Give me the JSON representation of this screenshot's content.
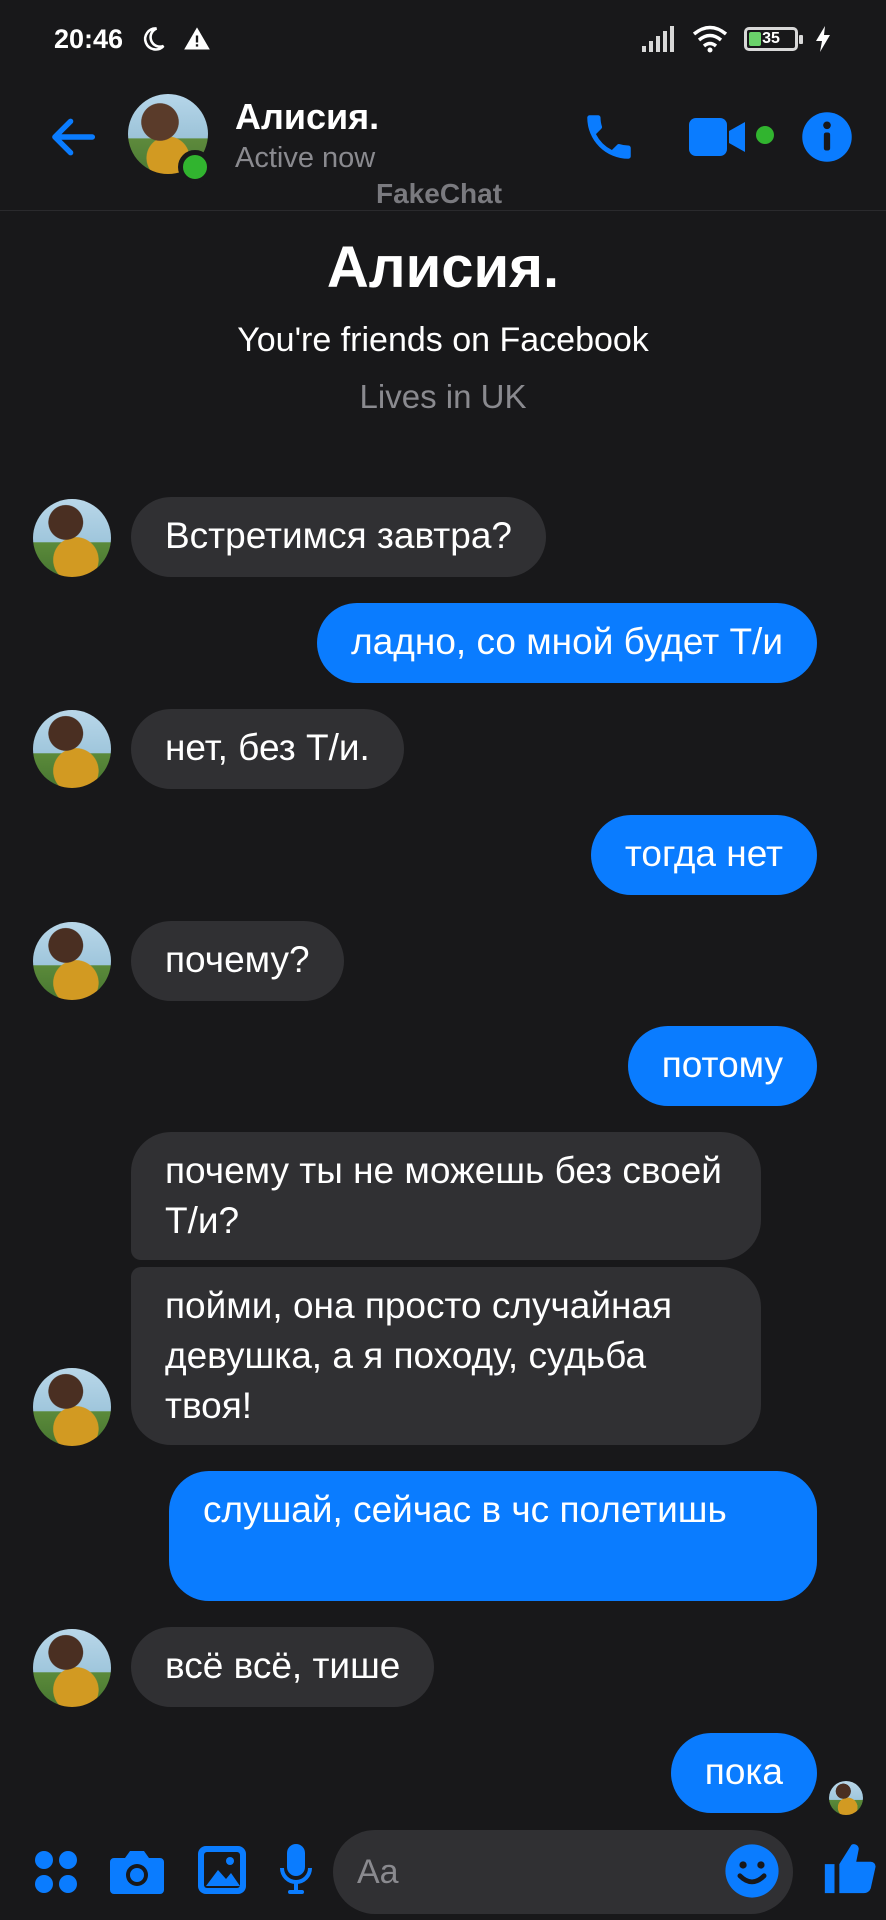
{
  "status_bar": {
    "time": "20:46",
    "battery": "35",
    "icons": [
      "moon-icon",
      "warning-icon",
      "signal-icon",
      "wifi-icon",
      "battery-icon",
      "charging-icon"
    ]
  },
  "header": {
    "name": "Алисия.",
    "status": "Active now",
    "watermark": "FakeChat",
    "accent_color": "#0a7cff",
    "online_color": "#31b42f"
  },
  "profile": {
    "name": "Алисия.",
    "friends": "You're friends on Facebook",
    "lives": "Lives in UK"
  },
  "messages": [
    {
      "from": "them",
      "text": "Встретимся завтра?"
    },
    {
      "from": "me",
      "text": "ладно, со мной будет Т/и"
    },
    {
      "from": "them",
      "text": "нет, без Т/и."
    },
    {
      "from": "me",
      "text": "тогда нет"
    },
    {
      "from": "them",
      "text": "почему?"
    },
    {
      "from": "me",
      "text": "потому"
    },
    {
      "from": "them",
      "text": "почему ты не можешь без своей Т/и?"
    },
    {
      "from": "them",
      "text": "пойми, она просто случайная девушка, а я походу, судьба твоя!"
    },
    {
      "from": "me",
      "text": "слушай, сейчас в чс полетишь"
    },
    {
      "from": "them",
      "text": "всё всё, тише"
    },
    {
      "from": "me",
      "text": "пока"
    }
  ],
  "composer": {
    "placeholder": "Aa"
  }
}
